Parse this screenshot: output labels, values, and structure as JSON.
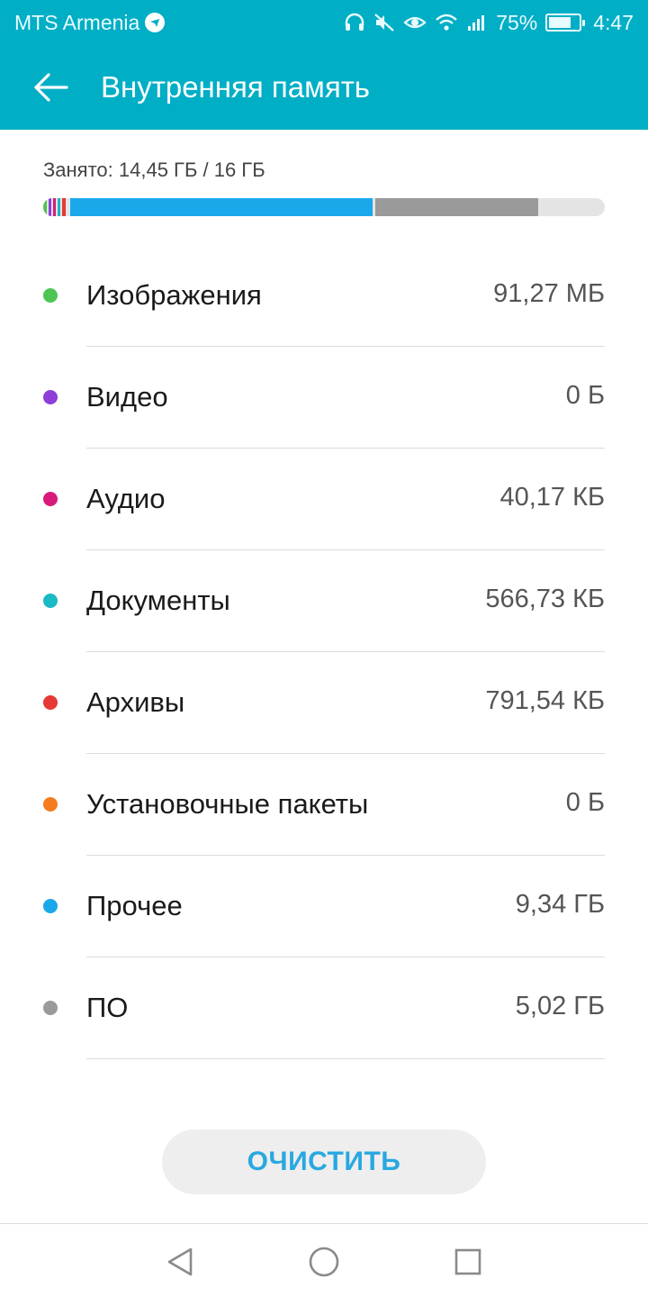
{
  "status_bar": {
    "carrier": "MTS Armenia",
    "battery_percent_text": "75%",
    "battery_level": 0.75,
    "time": "4:47",
    "icons": [
      "headset-icon",
      "mute-icon",
      "eye-icon",
      "wifi-icon",
      "signal-icon",
      "battery-charging-icon"
    ]
  },
  "app_bar": {
    "title": "Внутренняя память",
    "back_icon": "arrow-left-icon"
  },
  "usage": {
    "text": "Занято: 14,45 ГБ / 16 ГБ",
    "used_gb": 14.45,
    "total_gb": 16
  },
  "categories": [
    {
      "label": "Изображения",
      "value": "91,27 МБ",
      "color": "#4cc552"
    },
    {
      "label": "Видео",
      "value": "0 Б",
      "color": "#8e3fd8"
    },
    {
      "label": "Аудио",
      "value": "40,17 КБ",
      "color": "#d81b7a"
    },
    {
      "label": "Документы",
      "value": "566,73 КБ",
      "color": "#1bb9c4"
    },
    {
      "label": "Архивы",
      "value": "791,54 КБ",
      "color": "#e53935"
    },
    {
      "label": "Установочные пакеты",
      "value": "0 Б",
      "color": "#f57c1f"
    },
    {
      "label": "Прочее",
      "value": "9,34 ГБ",
      "color": "#1aa8ea"
    },
    {
      "label": "ПО",
      "value": "5,02 ГБ",
      "color": "#9a9a9a"
    }
  ],
  "clean_button": {
    "label": "ОЧИСТИТЬ"
  },
  "nav_bar": {
    "icons": [
      "back-triangle-icon",
      "home-circle-icon",
      "recents-square-icon"
    ]
  }
}
